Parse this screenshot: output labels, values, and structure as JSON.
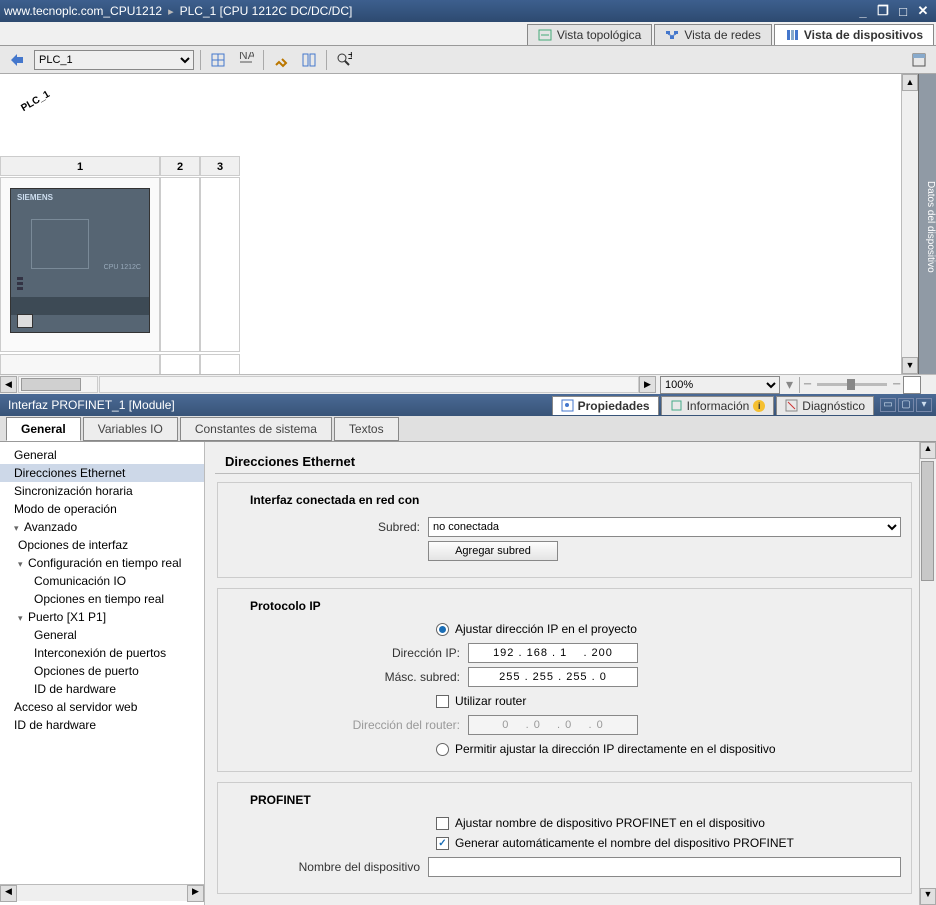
{
  "title": {
    "path1": "www.tecnoplc.com_CPU1212",
    "sep": "▸",
    "path2": "PLC_1 [CPU 1212C DC/DC/DC]"
  },
  "viewTabs": {
    "topo": "Vista topológica",
    "net": "Vista de redes",
    "dev": "Vista de dispositivos"
  },
  "toolbar": {
    "device": "PLC_1"
  },
  "canvas": {
    "label": "PLC_1",
    "slots": [
      "1",
      "2",
      "3"
    ],
    "brand": "SIEMENS",
    "cputxt": "CPU 1212C"
  },
  "zoom": "100%",
  "propHeader": {
    "title": "Interfaz PROFINET_1 [Module]",
    "tabs": {
      "prop": "Propiedades",
      "info": "Información",
      "diag": "Diagnóstico"
    }
  },
  "subTabs": {
    "gen": "General",
    "vio": "Variables IO",
    "cs": "Constantes de sistema",
    "tx": "Textos"
  },
  "tree": {
    "general": "General",
    "dirEth": "Direcciones Ethernet",
    "sync": "Sincronización horaria",
    "modo": "Modo de operación",
    "avanz": "Avanzado",
    "optIf": "Opciones de interfaz",
    "cfgRT": "Configuración en tiempo real",
    "comIO": "Comunicación IO",
    "optRT": "Opciones en tiempo real",
    "puerto": "Puerto [X1 P1]",
    "pgen": "General",
    "interc": "Interconexión de puertos",
    "optP": "Opciones de puerto",
    "idhw1": "ID de hardware",
    "acceso": "Acceso al servidor web",
    "idhw2": "ID de hardware"
  },
  "form": {
    "secTitle": "Direcciones Ethernet",
    "g1": {
      "title": "Interfaz conectada en red con",
      "subredLbl": "Subred:",
      "subredVal": "no conectada",
      "addBtn": "Agregar subred"
    },
    "g2": {
      "title": "Protocolo IP",
      "r1": "Ajustar dirección IP en el proyecto",
      "ipLbl": "Dirección IP:",
      "ipVal": "192 . 168 . 1    . 200",
      "maskLbl": "Másc. subred:",
      "maskVal": "255 . 255 . 255 . 0",
      "c1": "Utilizar router",
      "rtLbl": "Dirección del router:",
      "rtVal": "0    . 0    . 0    . 0",
      "r2": "Permitir ajustar la dirección IP directamente en el dispositivo"
    },
    "g3": {
      "title": "PROFINET",
      "c1": "Ajustar nombre de dispositivo PROFINET en el dispositivo",
      "c2": "Generar automáticamente el nombre del dispositivo PROFINET",
      "nameLbl": "Nombre del dispositivo"
    }
  },
  "sidepanel": "Datos del dispositivo"
}
